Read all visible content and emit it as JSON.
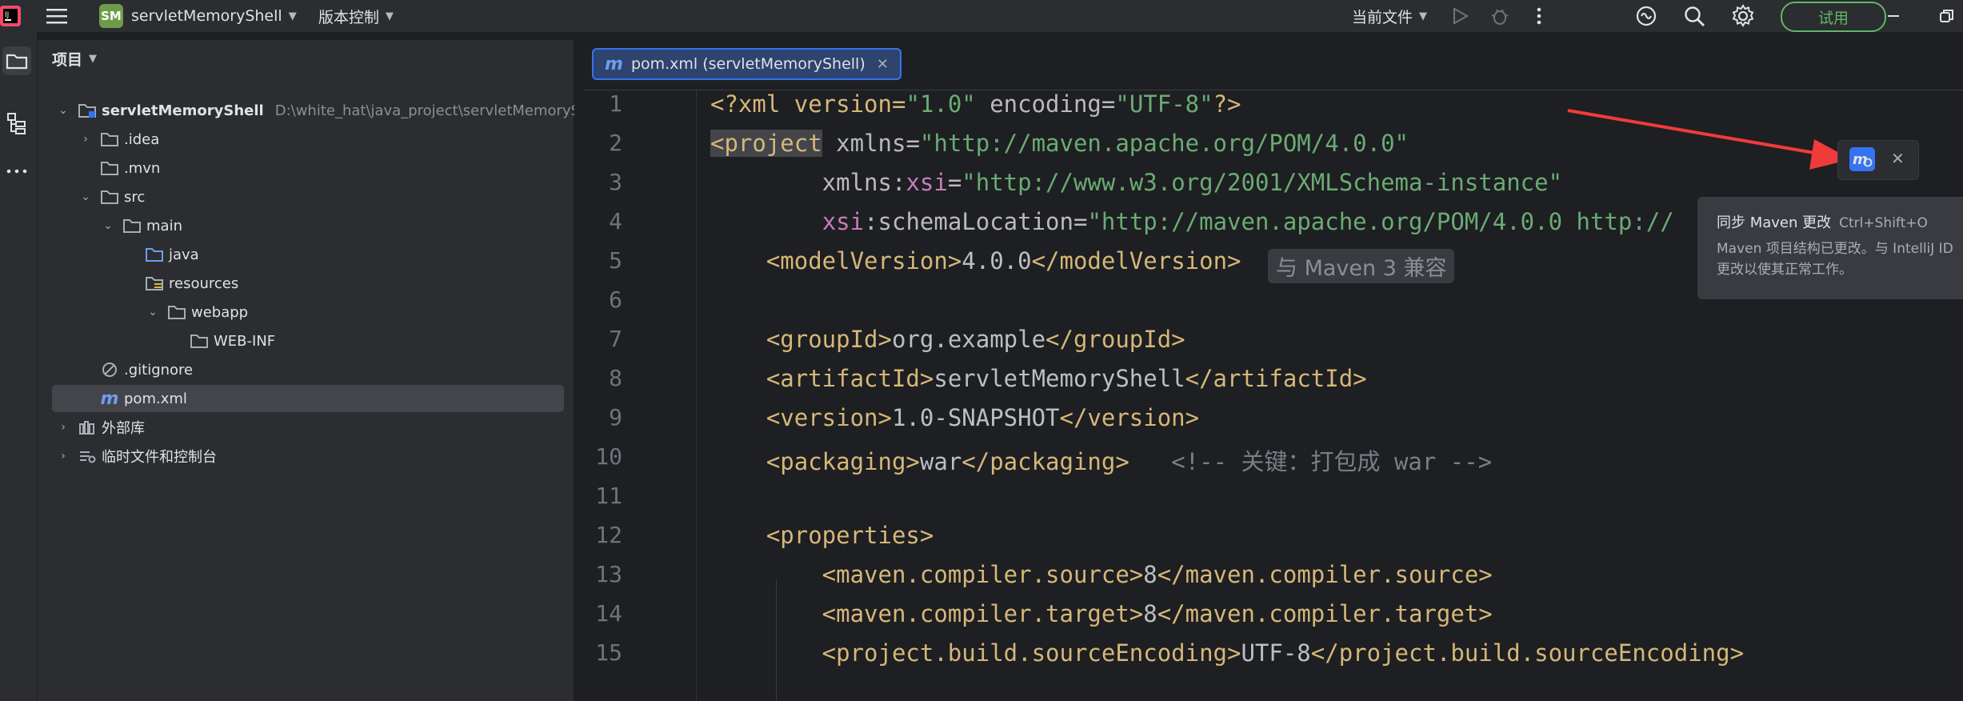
{
  "titlebar": {
    "project_badge": "SM",
    "project_name": "servletMemoryShell",
    "vcs_label": "版本控制",
    "run_config": "当前文件",
    "trial_label": "试用"
  },
  "project_panel": {
    "header": "项目",
    "tree": [
      {
        "label": "servletMemoryShell",
        "path": "D:\\white_hat\\java_project\\servletMemoryShell"
      },
      {
        "label": ".idea"
      },
      {
        "label": ".mvn"
      },
      {
        "label": "src"
      },
      {
        "label": "main"
      },
      {
        "label": "java"
      },
      {
        "label": "resources"
      },
      {
        "label": "webapp"
      },
      {
        "label": "WEB-INF"
      },
      {
        "label": ".gitignore"
      },
      {
        "label": "pom.xml"
      },
      {
        "label": "外部库"
      },
      {
        "label": "临时文件和控制台"
      }
    ]
  },
  "editor": {
    "tab_label": "pom.xml (servletMemoryShell)",
    "tab_icon": "m",
    "line_numbers": [
      "1",
      "2",
      "3",
      "4",
      "5",
      "6",
      "7",
      "8",
      "9",
      "10",
      "11",
      "12",
      "13",
      "14",
      "15"
    ],
    "inlay_hint": "与 Maven 3 兼容",
    "lines": {
      "l1": [
        "<?xml version=",
        "\"1.0\"",
        " encoding=",
        "\"UTF-8\"",
        "?>"
      ],
      "l2": [
        "<project",
        " xmlns=",
        "\"http://maven.apache.org/POM/4.0.0\""
      ],
      "l3": [
        "        xmlns:",
        "xsi",
        "=",
        "\"http://www.w3.org/2001/XMLSchema-instance\""
      ],
      "l4": [
        "        ",
        "xsi",
        ":schemaLocation=",
        "\"http://maven.apache.org/POM/4.0.0 http://"
      ],
      "l5": [
        "    <modelVersion>",
        "4.0.0",
        "</modelVersion>"
      ],
      "l7": [
        "    <groupId>",
        "org.example",
        "</groupId>"
      ],
      "l8": [
        "    <artifactId>",
        "servletMemoryShell",
        "</artifactId>"
      ],
      "l9": [
        "    <version>",
        "1.0-SNAPSHOT",
        "</version>"
      ],
      "l10": [
        "    <packaging>",
        "war",
        "</packaging>",
        "   <!-- 关键：打包成 war -->"
      ],
      "l12": [
        "    <properties>"
      ],
      "l13": [
        "        <maven.compiler.source>",
        "8",
        "</maven.compiler.source>"
      ],
      "l14": [
        "        <maven.compiler.target>",
        "8",
        "</maven.compiler.target>"
      ],
      "l15": [
        "        <project.build.sourceEncoding>",
        "UTF-8",
        "</project.build.sourceEncoding>"
      ]
    }
  },
  "maven_popup": {
    "title": "同步 Maven 更改",
    "shortcut": "Ctrl+Shift+O",
    "body": "Maven 项目结构已更改。与 IntelliJ ID\n更改以使其正常工作。"
  },
  "colors": {
    "accent": "#3574f0",
    "trial": "#5fb865",
    "annotation_arrow": "#f03b3b"
  }
}
